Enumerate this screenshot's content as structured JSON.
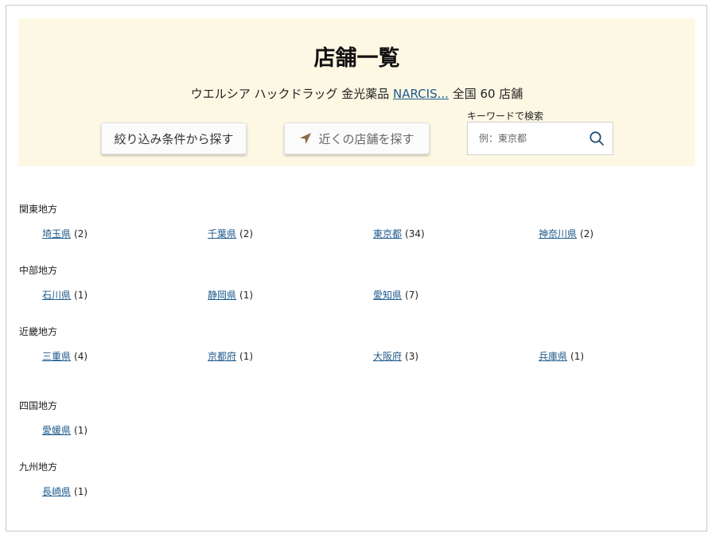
{
  "header": {
    "title": "店舗一覧",
    "subtitle_prefix": "ウエルシア ハックドラッグ 金光薬品",
    "subtitle_link": "NARCIS...",
    "subtitle_suffix": "全国 60 店舗"
  },
  "buttons": {
    "filter": "絞り込み条件から探す",
    "nearby": "近くの店舗を探す"
  },
  "search": {
    "label": "キーワードで検索",
    "placeholder": "例：東京都"
  },
  "icons": {
    "nearby": "location-arrow-icon",
    "search": "search-icon"
  },
  "colors": {
    "hero_bg": "#fdf8e4",
    "link": "#1d5a8c",
    "arrow": "#8a6a45",
    "search_icon": "#1d4f7a"
  },
  "regions": [
    {
      "name": "関東地方",
      "prefectures": [
        {
          "name": "埼玉県",
          "count": "(2)"
        },
        {
          "name": "千葉県",
          "count": "(2)"
        },
        {
          "name": "東京都",
          "count": "(34)"
        },
        {
          "name": "神奈川県",
          "count": "(2)"
        }
      ]
    },
    {
      "name": "中部地方",
      "prefectures": [
        {
          "name": "石川県",
          "count": "(1)"
        },
        {
          "name": "静岡県",
          "count": "(1)"
        },
        {
          "name": "愛知県",
          "count": "(7)"
        }
      ]
    },
    {
      "name": "近畿地方",
      "prefectures": [
        {
          "name": "三重県",
          "count": "(4)"
        },
        {
          "name": "京都府",
          "count": "(1)"
        },
        {
          "name": "大阪府",
          "count": "(3)"
        },
        {
          "name": "兵庫県",
          "count": "(1)"
        }
      ]
    },
    {
      "name": "四国地方",
      "prefectures": [
        {
          "name": "愛媛県",
          "count": "(1)"
        }
      ]
    },
    {
      "name": "九州地方",
      "prefectures": [
        {
          "name": "長崎県",
          "count": "(1)"
        }
      ]
    }
  ]
}
